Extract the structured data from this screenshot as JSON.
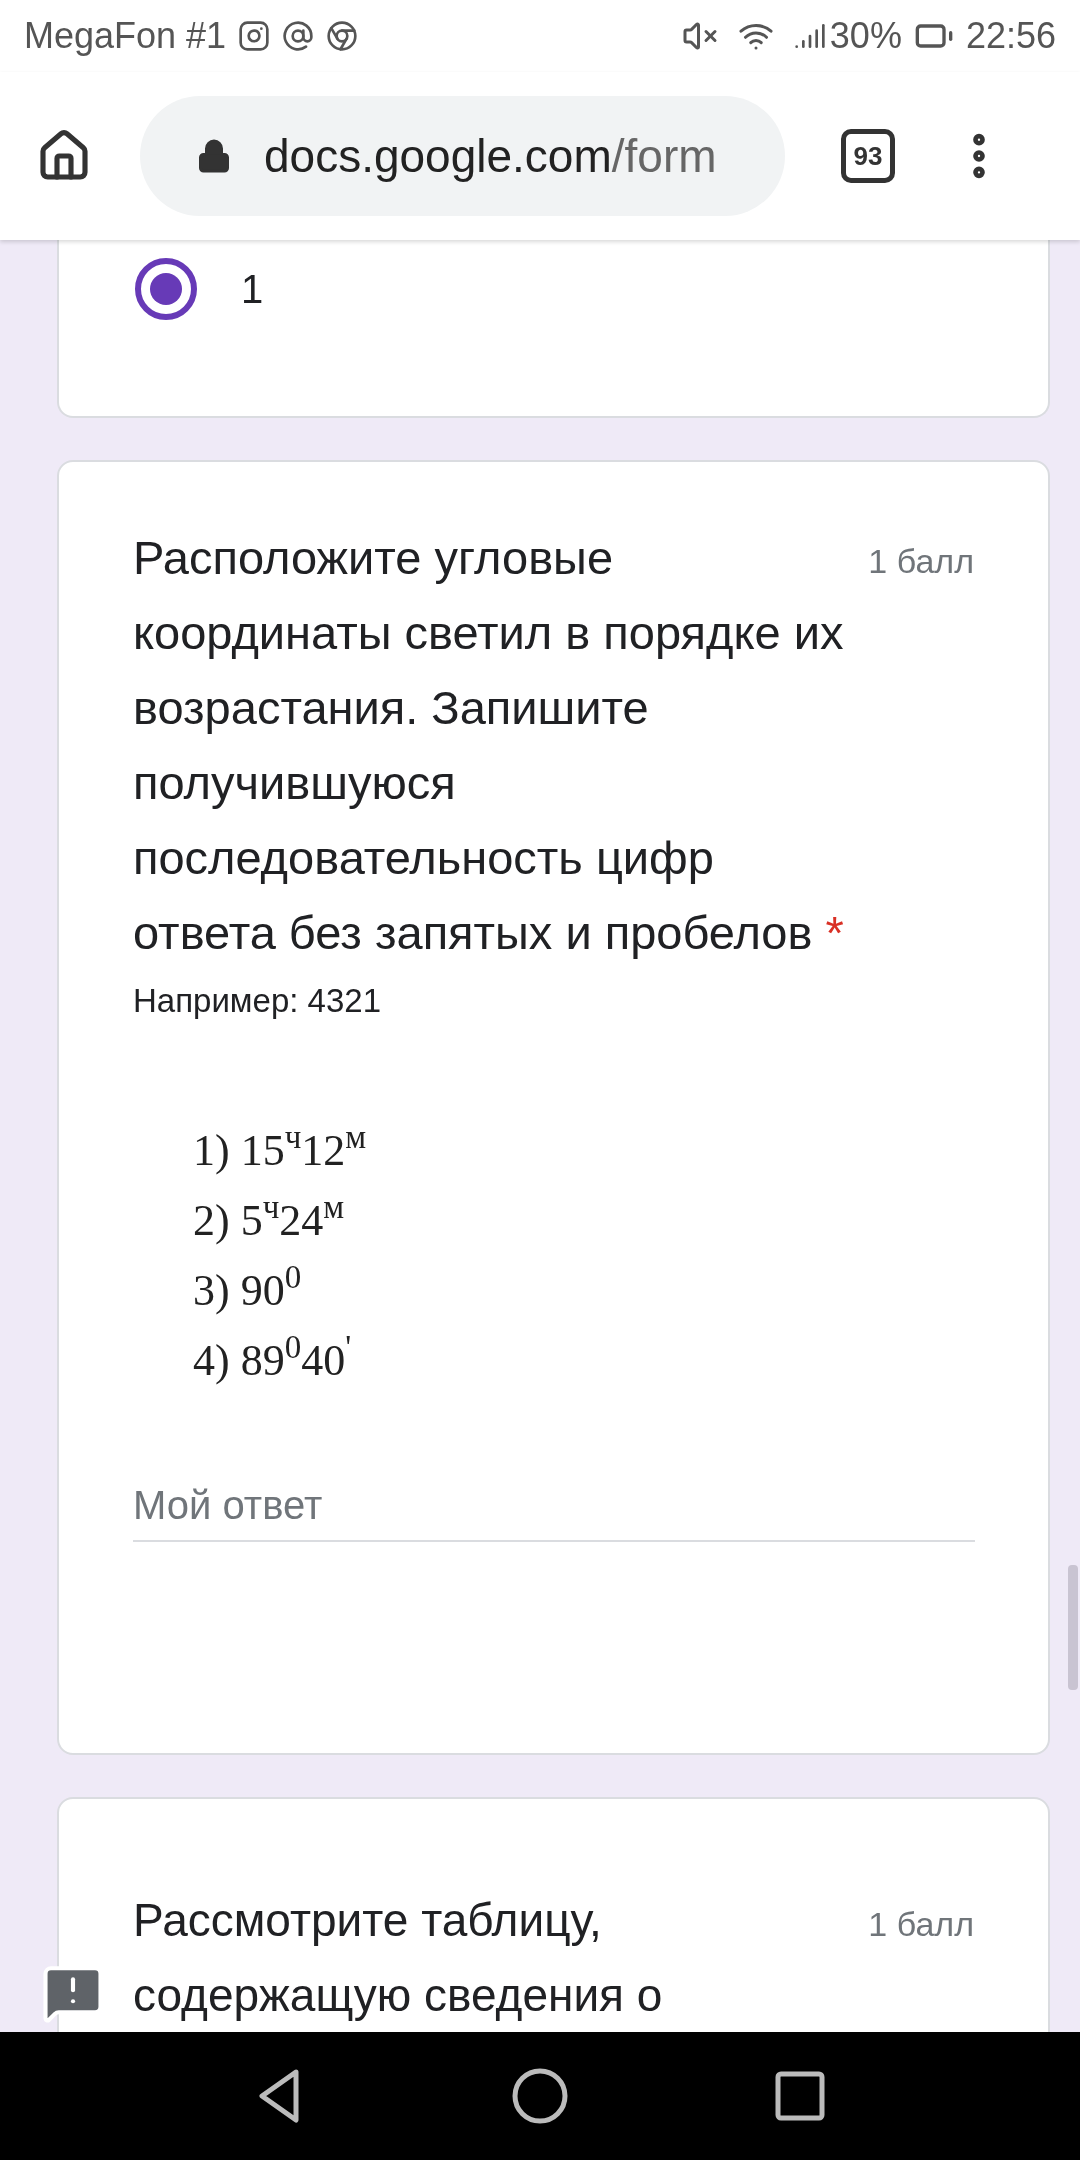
{
  "status_bar": {
    "carrier": "MegaFon #1",
    "battery": "30%",
    "time": "22:56"
  },
  "browser": {
    "url_host": "docs.google.com",
    "url_path": "/form",
    "tab_count": "93"
  },
  "previous_question": {
    "options": [
      {
        "label": "1",
        "selected": true
      }
    ]
  },
  "question": {
    "title": "Расположите угловые координаты светил в порядке их возрастания. Запишите получившуюся последовательность цифр ответа без запятых и пробелов",
    "required_mark": "*",
    "points": "1 балл",
    "hint": "Например: 4321",
    "image_lines": [
      "1) 15$^{ч}$12$^{м}$",
      "2) 5$^{ч}$24$^{м}$",
      "3) 90$^{0}$",
      "4) 89$^{0}$40$^{'}$"
    ],
    "answer": {
      "placeholder": "Мой ответ"
    }
  },
  "next_question": {
    "title_lines": [
      "Рассмотрите таблицу,",
      "содержащую сведения о"
    ],
    "points": "1 балл"
  }
}
